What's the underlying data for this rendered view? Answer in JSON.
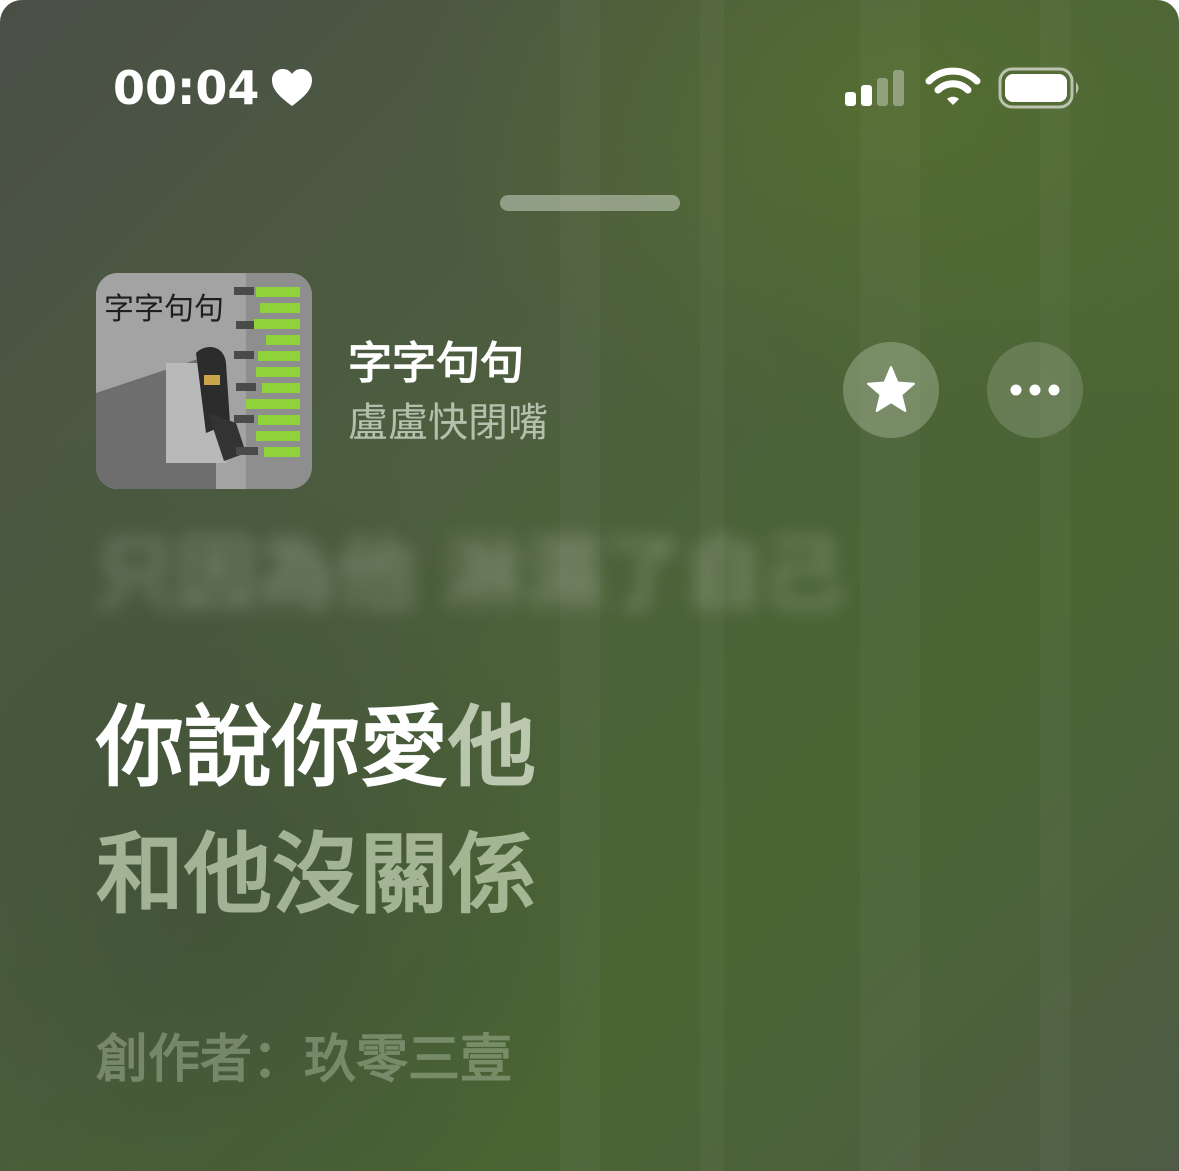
{
  "status_bar": {
    "time": "00:04",
    "focus_icon": "heart-icon",
    "signal_icon": "cellular-signal-icon",
    "wifi_icon": "wifi-icon",
    "battery_icon": "battery-icon"
  },
  "now_playing": {
    "artwork_icon": "album-artwork",
    "artwork_text": "字字句句",
    "title": "字字句句",
    "artist": "盧盧快閉嘴",
    "favorite_icon": "star-icon",
    "more_icon": "ellipsis-icon"
  },
  "lyrics": {
    "previous_line": "只因為他 淋濕了自己",
    "current_line_highlight": "你說你愛",
    "current_line_rest": "他",
    "next_line": "和他沒關係",
    "credits": "創作者：玖零三壹"
  },
  "colors": {
    "accent_green": "#8fd23a",
    "background_green": "#4b6632",
    "background_gray": "#4a4f46"
  }
}
